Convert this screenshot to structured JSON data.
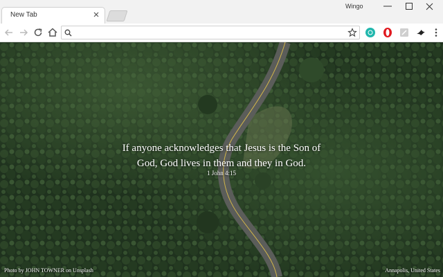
{
  "tab": {
    "title": "New Tab"
  },
  "window": {
    "profile_name": "Wingo"
  },
  "omnibox": {
    "value": "",
    "placeholder": ""
  },
  "extensions": [
    "teal-circle-extension-icon",
    "opera-extension-icon",
    "grey-extension-icon",
    "bird-extension-icon"
  ],
  "quote": {
    "line1": "If anyone acknowledges that Jesus is the Son of",
    "line2": "God, God lives in them and they in God.",
    "reference": "1 John 4:15"
  },
  "footer": {
    "photo_credit": "Photo by JOHN TOWNER on Unsplash",
    "location": "Annapolis, United States"
  },
  "colors": {
    "forest": "#20331f",
    "road": "#5b5d5a",
    "road_line": "#d2b64a"
  }
}
